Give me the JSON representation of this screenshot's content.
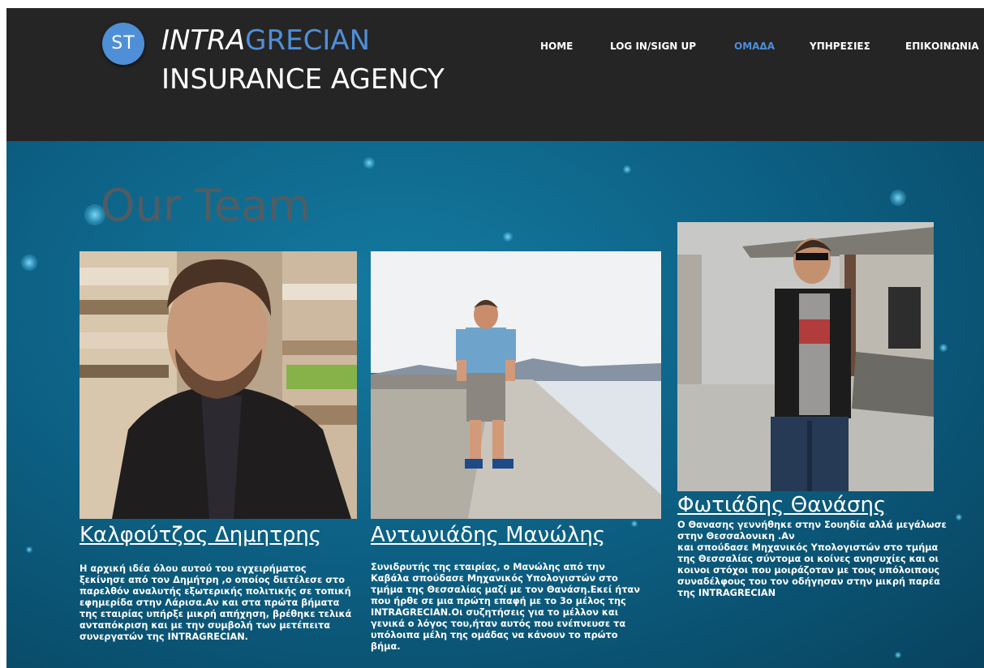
{
  "brand": {
    "badge": "ST",
    "name_part1": "INTRA",
    "name_part2": "GRECIAN",
    "subtitle": "INSURANCE AGENCY",
    "accent_color": "#4f8fd8"
  },
  "nav": {
    "items": [
      {
        "label": "HOME",
        "active": false
      },
      {
        "label": "LOG IN/SIGN UP",
        "active": false
      },
      {
        "label": "ΟΜΑΔΑ",
        "active": true
      },
      {
        "label": "ΥΠΗΡΕΣΙΕΣ",
        "active": false
      },
      {
        "label": "ΕΠΙΚΟΙΝΩΝΙΑ",
        "active": false
      }
    ]
  },
  "page": {
    "title": "Our Team"
  },
  "team": [
    {
      "name": "Καλφούτζος Δημητρης",
      "photo_icon": "person-photo",
      "bio_lines": [
        "Η αρχική ιδέα όλου αυτού του εγχειρήματος",
        "ξεκίνησε από τον Δημήτρη ,ο οποίος διετέλεσε στο",
        "παρελθόν αναλυτής εξωτερικής πολιτικής σε τοπική",
        "εφημερίδα στην Λάρισα.Αν και στα πρώτα βήματα",
        "της εταιρίας υπήρξε μικρή απήχηση, βρέθηκε τελικά",
        "ανταπόκριση και με την συμβολή των μετέπειτα",
        "συνεργατών της INTRAGRECIAN."
      ]
    },
    {
      "name": "Αντωνιάδης Μανώλης",
      "photo_icon": "person-photo",
      "bio_lines": [
        "Συνιδρυτής της εταιρίας, ο Μανώλης από την",
        "Καβάλα σπούδασε Μηχανικός Υπολογιστών στο",
        "τμήμα της Θεσσαλίας μαζί με τον Θανάση.Εκεί ήταν",
        "που ήρθε σε μια πρώτη επαφή με το 3ο μέλος της",
        "INTRAGRECIAN.Οι συζητήσεις για το μέλλον και",
        "γενικά ο λόγος του,ήταν αυτός που ενέπνευσε τα",
        "υπόλοιπα μέλη της ομάδας να κάνουν το πρώτο",
        "βήμα."
      ]
    },
    {
      "name": "Φωτιάδης Θανάσης",
      "photo_icon": "person-photo",
      "bio_lines": [
        "Ο Θανασης γεννήθηκε στην Σουηδία αλλά μεγάλωσε",
        "στην Θεσσαλονικη .Αν",
        "και σπούδασε Μηχανικός Υπολογιστών στο τμήμα",
        "της Θεσσαλίας σύντομα οι κοίνες ανησυχίες και οι",
        "κοινοι στόχοι που μοιράζοταν με τους υπόλοιπους",
        "συναδέλφους του τον οδήγησαν στην μικρή παρέα",
        "της INTRAGRECIAN"
      ]
    }
  ]
}
